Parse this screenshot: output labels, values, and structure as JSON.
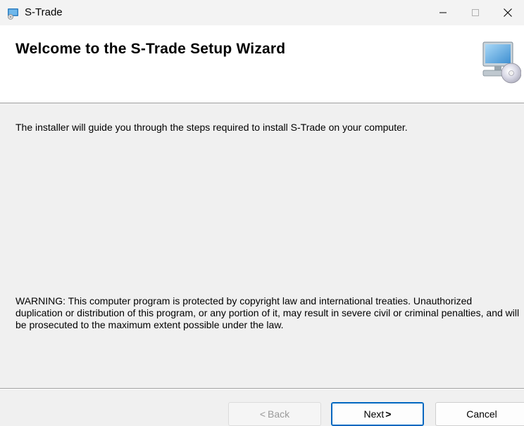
{
  "window": {
    "title": "S-Trade",
    "app_icon": "installer-app-icon",
    "controls": {
      "minimize_icon": "minimize-icon",
      "maximize_icon": "maximize-icon",
      "close_icon": "close-icon"
    }
  },
  "banner": {
    "title": "Welcome to the S-Trade Setup Wizard",
    "graphic_icon": "computer-cd-icon"
  },
  "body": {
    "intro": "The installer will guide you through the steps required to install S-Trade on your computer.",
    "warning": "WARNING: This computer program is protected by copyright law and international treaties. Unauthorized duplication or distribution of this program, or any portion of it, may result in severe civil or criminal penalties, and will be prosecuted to the maximum extent possible under the law."
  },
  "buttons": {
    "back_label": "Back",
    "back_arrow": "<",
    "next_label": "Next",
    "next_arrow": ">",
    "cancel_label": "Cancel"
  },
  "colors": {
    "accent": "#0067c0",
    "window_bg": "#f0f0f0",
    "banner_bg": "#ffffff"
  }
}
